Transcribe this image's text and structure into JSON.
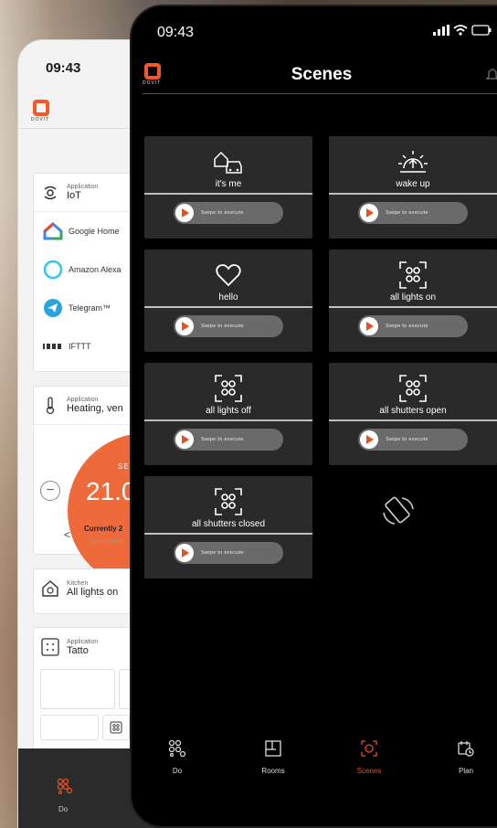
{
  "colors": {
    "accent": "#e8501e",
    "logo": "#f05a28",
    "dark_bg": "#000000",
    "card_dark": "#2a2a2a",
    "thermo": "#ef6a3a"
  },
  "back_phone": {
    "time": "09:43",
    "logo_text": "DOVIT",
    "iot_card": {
      "small": "Application",
      "big": "IoT",
      "items": [
        {
          "icon": "google-home-icon",
          "label": "Google Home"
        },
        {
          "icon": "amazon-alexa-icon",
          "label": "Amazon Alexa"
        },
        {
          "icon": "telegram-icon",
          "label": "Telegram™"
        },
        {
          "icon": "ifttt-icon",
          "label": "IFTTT"
        }
      ]
    },
    "heating_card": {
      "small": "Application",
      "big": "Heating, ven"
    },
    "thermostat": {
      "set_label": "SET TO",
      "temperature": "21.0",
      "currently": "Currently 2",
      "room": "Living roo"
    },
    "kitchen_card": {
      "small": "Kitchen",
      "big": "All lights on"
    },
    "tatto_card": {
      "small": "Application",
      "big": "Tatto"
    },
    "nav": {
      "do_label": "Do"
    }
  },
  "front_phone": {
    "time": "09:43",
    "logo_text": "DOVIT",
    "title": "Scenes",
    "swipe_label": "Swipe to execute",
    "scenes": [
      {
        "name": "it's me",
        "icon": "home-car-icon"
      },
      {
        "name": "wake up",
        "icon": "sunrise-icon"
      },
      {
        "name": "hello",
        "icon": "heart-icon"
      },
      {
        "name": "all lights on",
        "icon": "scene-icon"
      },
      {
        "name": "all lights off",
        "icon": "scene-icon"
      },
      {
        "name": "all shutters open",
        "icon": "scene-icon"
      },
      {
        "name": "all shutters closed",
        "icon": "scene-icon"
      }
    ],
    "nav": [
      {
        "label": "Do",
        "icon": "grid-icon",
        "active": false
      },
      {
        "label": "Rooms",
        "icon": "floorplan-icon",
        "active": false
      },
      {
        "label": "Scenes",
        "icon": "scenes-icon",
        "active": true
      },
      {
        "label": "Plan",
        "icon": "calendar-clock-icon",
        "active": false
      }
    ]
  }
}
